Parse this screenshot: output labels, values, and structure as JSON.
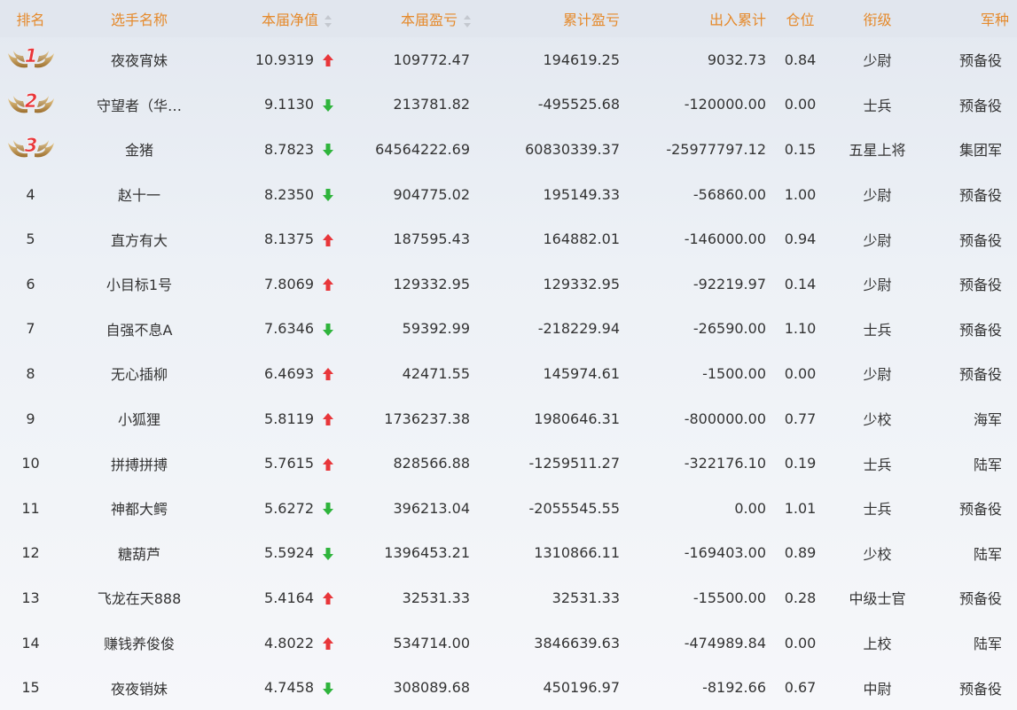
{
  "colors": {
    "header_text": "#e58a2c",
    "up_arrow": "#e8363a",
    "down_arrow": "#2fb43c"
  },
  "columns": {
    "rank": "排名",
    "name": "选手名称",
    "nav": "本届净值",
    "pnl": "本届盈亏",
    "cum_pnl": "累计盈亏",
    "flow": "出入累计",
    "position": "仓位",
    "grade": "衔级",
    "branch": "军种"
  },
  "rows": [
    {
      "rank": "1",
      "medal": "medal-wings-icon",
      "name": "夜夜宵妹",
      "nav": "10.9319",
      "trend": "up",
      "pnl": "109772.47",
      "cum_pnl": "194619.25",
      "flow": "9032.73",
      "position": "0.84",
      "grade": "少尉",
      "branch": "预备役"
    },
    {
      "rank": "2",
      "medal": "medal-wings-icon",
      "name": "守望者（华…",
      "nav": "9.1130",
      "trend": "down",
      "pnl": "213781.82",
      "cum_pnl": "-495525.68",
      "flow": "-120000.00",
      "position": "0.00",
      "grade": "士兵",
      "branch": "预备役"
    },
    {
      "rank": "3",
      "medal": "medal-wings-icon",
      "name": "金猪",
      "nav": "8.7823",
      "trend": "down",
      "pnl": "64564222.69",
      "cum_pnl": "60830339.37",
      "flow": "-25977797.12",
      "position": "0.15",
      "grade": "五星上将",
      "branch": "集团军"
    },
    {
      "rank": "4",
      "name": "赵十一",
      "nav": "8.2350",
      "trend": "down",
      "pnl": "904775.02",
      "cum_pnl": "195149.33",
      "flow": "-56860.00",
      "position": "1.00",
      "grade": "少尉",
      "branch": "预备役"
    },
    {
      "rank": "5",
      "name": "直方有大",
      "nav": "8.1375",
      "trend": "up",
      "pnl": "187595.43",
      "cum_pnl": "164882.01",
      "flow": "-146000.00",
      "position": "0.94",
      "grade": "少尉",
      "branch": "预备役"
    },
    {
      "rank": "6",
      "name": "小目标1号",
      "nav": "7.8069",
      "trend": "up",
      "pnl": "129332.95",
      "cum_pnl": "129332.95",
      "flow": "-92219.97",
      "position": "0.14",
      "grade": "少尉",
      "branch": "预备役"
    },
    {
      "rank": "7",
      "name": "自强不息A",
      "nav": "7.6346",
      "trend": "down",
      "pnl": "59392.99",
      "cum_pnl": "-218229.94",
      "flow": "-26590.00",
      "position": "1.10",
      "grade": "士兵",
      "branch": "预备役"
    },
    {
      "rank": "8",
      "name": "无心插柳",
      "nav": "6.4693",
      "trend": "up",
      "pnl": "42471.55",
      "cum_pnl": "145974.61",
      "flow": "-1500.00",
      "position": "0.00",
      "grade": "少尉",
      "branch": "预备役"
    },
    {
      "rank": "9",
      "name": "小狐狸",
      "nav": "5.8119",
      "trend": "up",
      "pnl": "1736237.38",
      "cum_pnl": "1980646.31",
      "flow": "-800000.00",
      "position": "0.77",
      "grade": "少校",
      "branch": "海军"
    },
    {
      "rank": "10",
      "name": "拼搏拼搏",
      "nav": "5.7615",
      "trend": "up",
      "pnl": "828566.88",
      "cum_pnl": "-1259511.27",
      "flow": "-322176.10",
      "position": "0.19",
      "grade": "士兵",
      "branch": "陆军"
    },
    {
      "rank": "11",
      "name": "神都大鳄",
      "nav": "5.6272",
      "trend": "down",
      "pnl": "396213.04",
      "cum_pnl": "-2055545.55",
      "flow": "0.00",
      "position": "1.01",
      "grade": "士兵",
      "branch": "预备役"
    },
    {
      "rank": "12",
      "name": "糖葫芦",
      "nav": "5.5924",
      "trend": "down",
      "pnl": "1396453.21",
      "cum_pnl": "1310866.11",
      "flow": "-169403.00",
      "position": "0.89",
      "grade": "少校",
      "branch": "陆军"
    },
    {
      "rank": "13",
      "name": "飞龙在天888",
      "nav": "5.4164",
      "trend": "up",
      "pnl": "32531.33",
      "cum_pnl": "32531.33",
      "flow": "-15500.00",
      "position": "0.28",
      "grade": "中级士官",
      "branch": "预备役"
    },
    {
      "rank": "14",
      "name": "赚钱养俊俊",
      "nav": "4.8022",
      "trend": "up",
      "pnl": "534714.00",
      "cum_pnl": "3846639.63",
      "flow": "-474989.84",
      "position": "0.00",
      "grade": "上校",
      "branch": "陆军"
    },
    {
      "rank": "15",
      "name": "夜夜销妹",
      "nav": "4.7458",
      "trend": "down",
      "pnl": "308089.68",
      "cum_pnl": "450196.97",
      "flow": "-8192.66",
      "position": "0.67",
      "grade": "中尉",
      "branch": "预备役"
    }
  ]
}
